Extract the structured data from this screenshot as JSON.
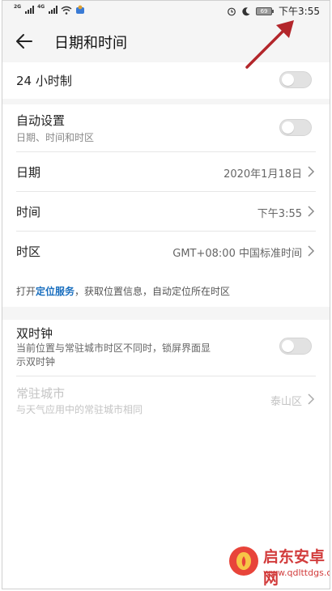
{
  "status_bar": {
    "net1": "2G",
    "net2": "4G",
    "battery": "69",
    "time": "下午3:55"
  },
  "header": {
    "title": "日期和时间"
  },
  "rows": {
    "hour24": {
      "label": "24 小时制",
      "toggle_on": false
    },
    "auto": {
      "label": "自动设置",
      "sub": "日期、时间和时区",
      "toggle_on": false
    },
    "date": {
      "label": "日期",
      "value": "2020年1月18日"
    },
    "time": {
      "label": "时间",
      "value": "下午3:55"
    },
    "timezone": {
      "label": "时区",
      "value": "GMT+08:00 中国标准时间"
    }
  },
  "hint": {
    "prefix": "打开",
    "link": "定位服务",
    "suffix": "，获取位置信息，自动定位所在时区"
  },
  "dual_clock": {
    "label": "双时钟",
    "sub_line1": "当前位置与常驻城市时区不同时，锁屏界面显",
    "sub_line2": "示双时钟",
    "toggle_on": false
  },
  "home_city": {
    "label": "常驻城市",
    "sub": "与天气应用中的常驻城市相同",
    "value": "泰山区"
  },
  "watermark": {
    "line1": "启东安卓网",
    "line2": "www.qdlttdgs.com"
  },
  "colors": {
    "link": "#1a6fbf",
    "annotation_arrow": "#b3262b",
    "watermark": "#d23c3c"
  }
}
